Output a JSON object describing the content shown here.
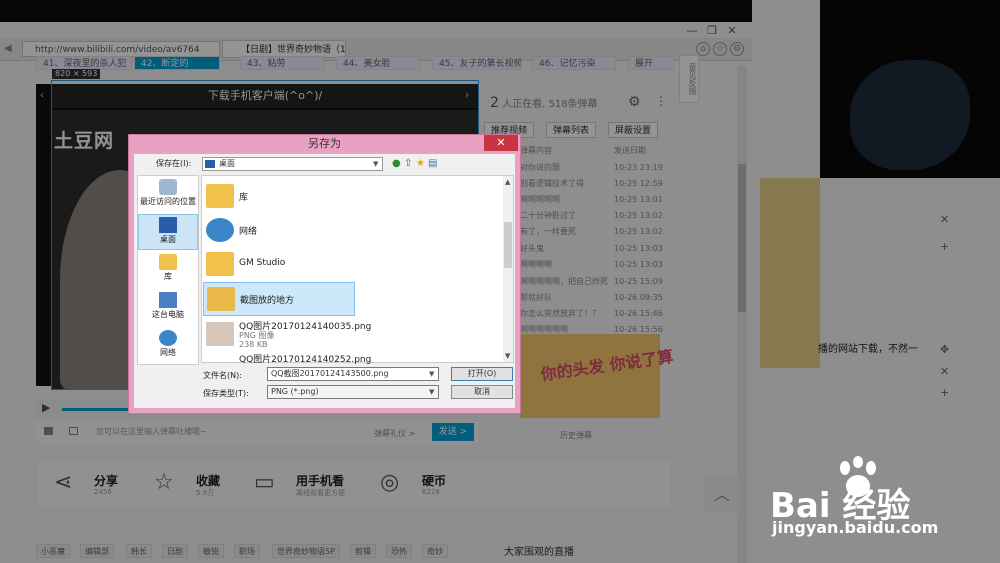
{
  "browser": {
    "url": "http://www.bilibili.com/video/av6764",
    "tab_title": "【日剧】世界奇妙物语（1...",
    "window_controls": [
      "—",
      "❐",
      "✕"
    ],
    "episodes": [
      "41、深夜里的杀人犯",
      "42、断定的",
      "43、粘劳",
      "44、美女脸",
      "45、友子的第长视频",
      "46、记忆污染",
      "展开"
    ],
    "side_feedback": "意见反馈"
  },
  "player": {
    "size_label": "820 × 593",
    "top_banner": "下载手机客户端(^o^)/",
    "watermark": "土豆网",
    "danmu_placeholder": "您可以在这里输入弹幕吐槽哦~",
    "danmu_etiquette": "弹幕礼仪 >",
    "send": "发送 >"
  },
  "danmu_panel": {
    "online_count": "2",
    "online_text": "人正在看, 518条弹幕",
    "tabs": [
      "推荐视频",
      "弹幕列表",
      "屏蔽设置"
    ],
    "header": [
      "弹幕内容",
      "发送日期"
    ],
    "rows": [
      {
        "text": "对你说的题",
        "date": "10-23 23:19"
      },
      {
        "text": "别看逻辑技术了得",
        "date": "10-25 12:59"
      },
      {
        "text": "啊啊啊啊啊",
        "date": "10-25 13:01"
      },
      {
        "text": "二十分钟卧过了",
        "date": "10-25 13:02"
      },
      {
        "text": "有了，一样要死",
        "date": "10-25 13:02"
      },
      {
        "text": "好头鬼",
        "date": "10-25 13:03"
      },
      {
        "text": "啊啊啊啊",
        "date": "10-25 13:03"
      },
      {
        "text": "啊啊啊啊啊，把自己炸死",
        "date": "10-25 15:09"
      },
      {
        "text": "那就好队",
        "date": "10-26 09:35"
      },
      {
        "text": "你怎么突然放弃了！？",
        "date": "10-26 15:46"
      },
      {
        "text": "啊啊啊啊啊啊",
        "date": "10-26 15:56"
      }
    ],
    "ad_text": "你的头发 你说了算",
    "history": "历史弹幕"
  },
  "share_bar": {
    "items": [
      {
        "label": "分享",
        "sub": "2456",
        "icon": "share-icon"
      },
      {
        "label": "收藏",
        "sub": "5.9万",
        "icon": "star-icon"
      },
      {
        "label": "用手机看",
        "sub": "离线观看更方便",
        "icon": "phone-icon"
      },
      {
        "label": "硬币",
        "sub": "6228",
        "icon": "coin-icon"
      }
    ]
  },
  "tags": [
    "小恶魔",
    "编辑部",
    "韩长",
    "日剧",
    "敏锐",
    "职场",
    "世界奇妙物语SP",
    "剪辑",
    "恐怖",
    "奇妙"
  ],
  "live_heading": "大家围观的直播",
  "right_text": "播的网站下载，不然一",
  "dialog": {
    "title": "另存为",
    "close": "✕",
    "save_in_label": "保存在(I):",
    "save_in_value": "桌面",
    "places": [
      "最近访问的位置",
      "桌面",
      "库",
      "这台电脑",
      "网络"
    ],
    "files": [
      {
        "name": "库",
        "sub": "",
        "sub2": ""
      },
      {
        "name": "网络",
        "sub": "",
        "sub2": ""
      },
      {
        "name": "GM Studio",
        "sub": "",
        "sub2": ""
      },
      {
        "name": "截图放的地方",
        "sub": "",
        "sub2": ""
      },
      {
        "name": "QQ图片20170124140035.png",
        "sub": "PNG 图像",
        "sub2": "238 KB"
      },
      {
        "name": "QQ图片20170124140252.png",
        "sub": "",
        "sub2": ""
      }
    ],
    "filename_label": "文件名(N):",
    "filename_value": "QQ截图20170124143500.png",
    "filetype_label": "保存类型(T):",
    "filetype_value": "PNG (*.png)",
    "open_btn": "打开(O)",
    "cancel_btn": "取消"
  },
  "watermark": {
    "brand": "Bai  经验",
    "url": "jingyan.baidu.com"
  }
}
